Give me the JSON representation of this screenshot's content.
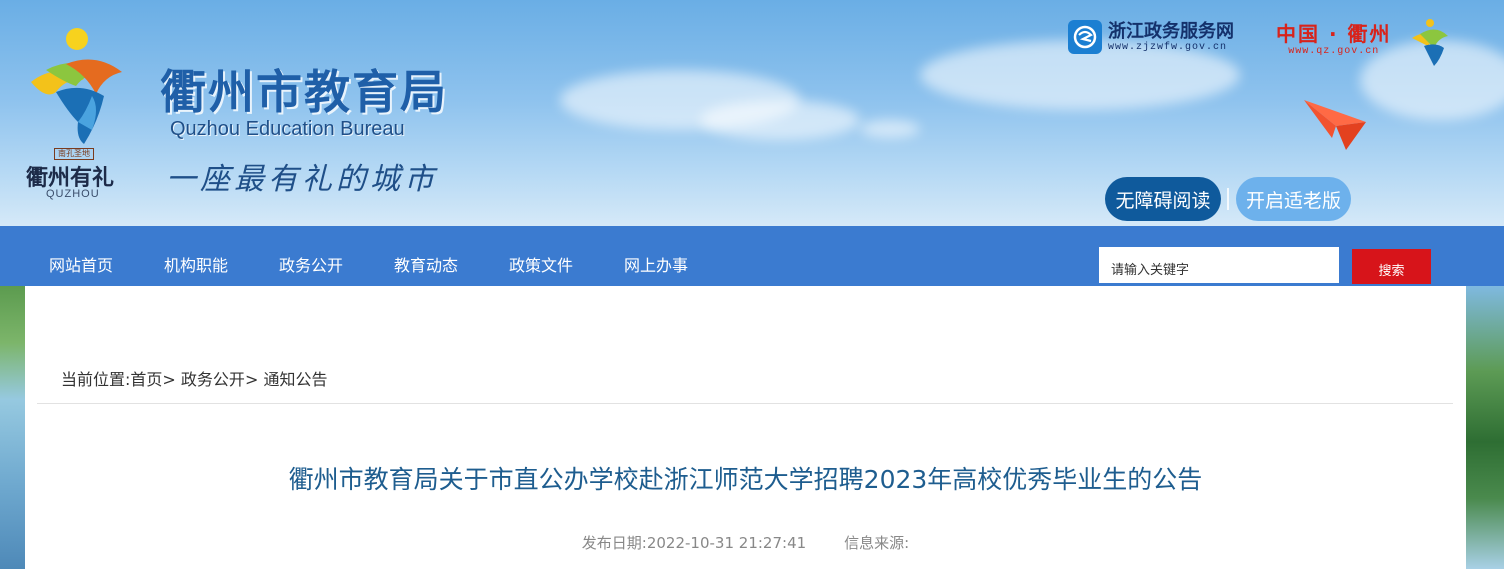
{
  "header": {
    "title_cn": "衢州市教育局",
    "title_en": "Quzhou Education Bureau",
    "slogan": "一座最有礼的城市",
    "emblem": {
      "seal_text": "南孔圣地",
      "text": "衢州有礼",
      "pinyin": "QUZHOU",
      "icon": "quzhou-emblem-icon"
    },
    "links": {
      "zj_name": "浙江政务服务网",
      "zj_url": "www.zjzwfw.gov.cn",
      "qz_name": "中国 · 衢州",
      "qz_url": "www.qz.gov.cn"
    },
    "accessibility_button": "无障碍阅读",
    "elder_button": "开启适老版"
  },
  "nav": {
    "items": [
      "网站首页",
      "机构职能",
      "政务公开",
      "教育动态",
      "政策文件",
      "网上办事"
    ],
    "search_placeholder": "请输入关键字",
    "search_button": "搜索"
  },
  "breadcrumb": {
    "prefix": "当前位置:",
    "items": [
      "首页",
      "政务公开",
      "通知公告"
    ],
    "separator": ">"
  },
  "article": {
    "title": "衢州市教育局关于市直公办学校赴浙江师范大学招聘2023年高校优秀毕业生的公告",
    "publish_label": "发布日期:",
    "publish_date": "2022-10-31 21:27:41",
    "source_label": "信息来源:",
    "source_value": ""
  },
  "colors": {
    "nav_bg": "#3b7bd0",
    "title_blue": "#1f5fa8",
    "search_button": "#d7141a",
    "accessible_button": "#0f5a9c",
    "elder_button": "#6db1ec",
    "article_title": "#1e5d8f"
  }
}
